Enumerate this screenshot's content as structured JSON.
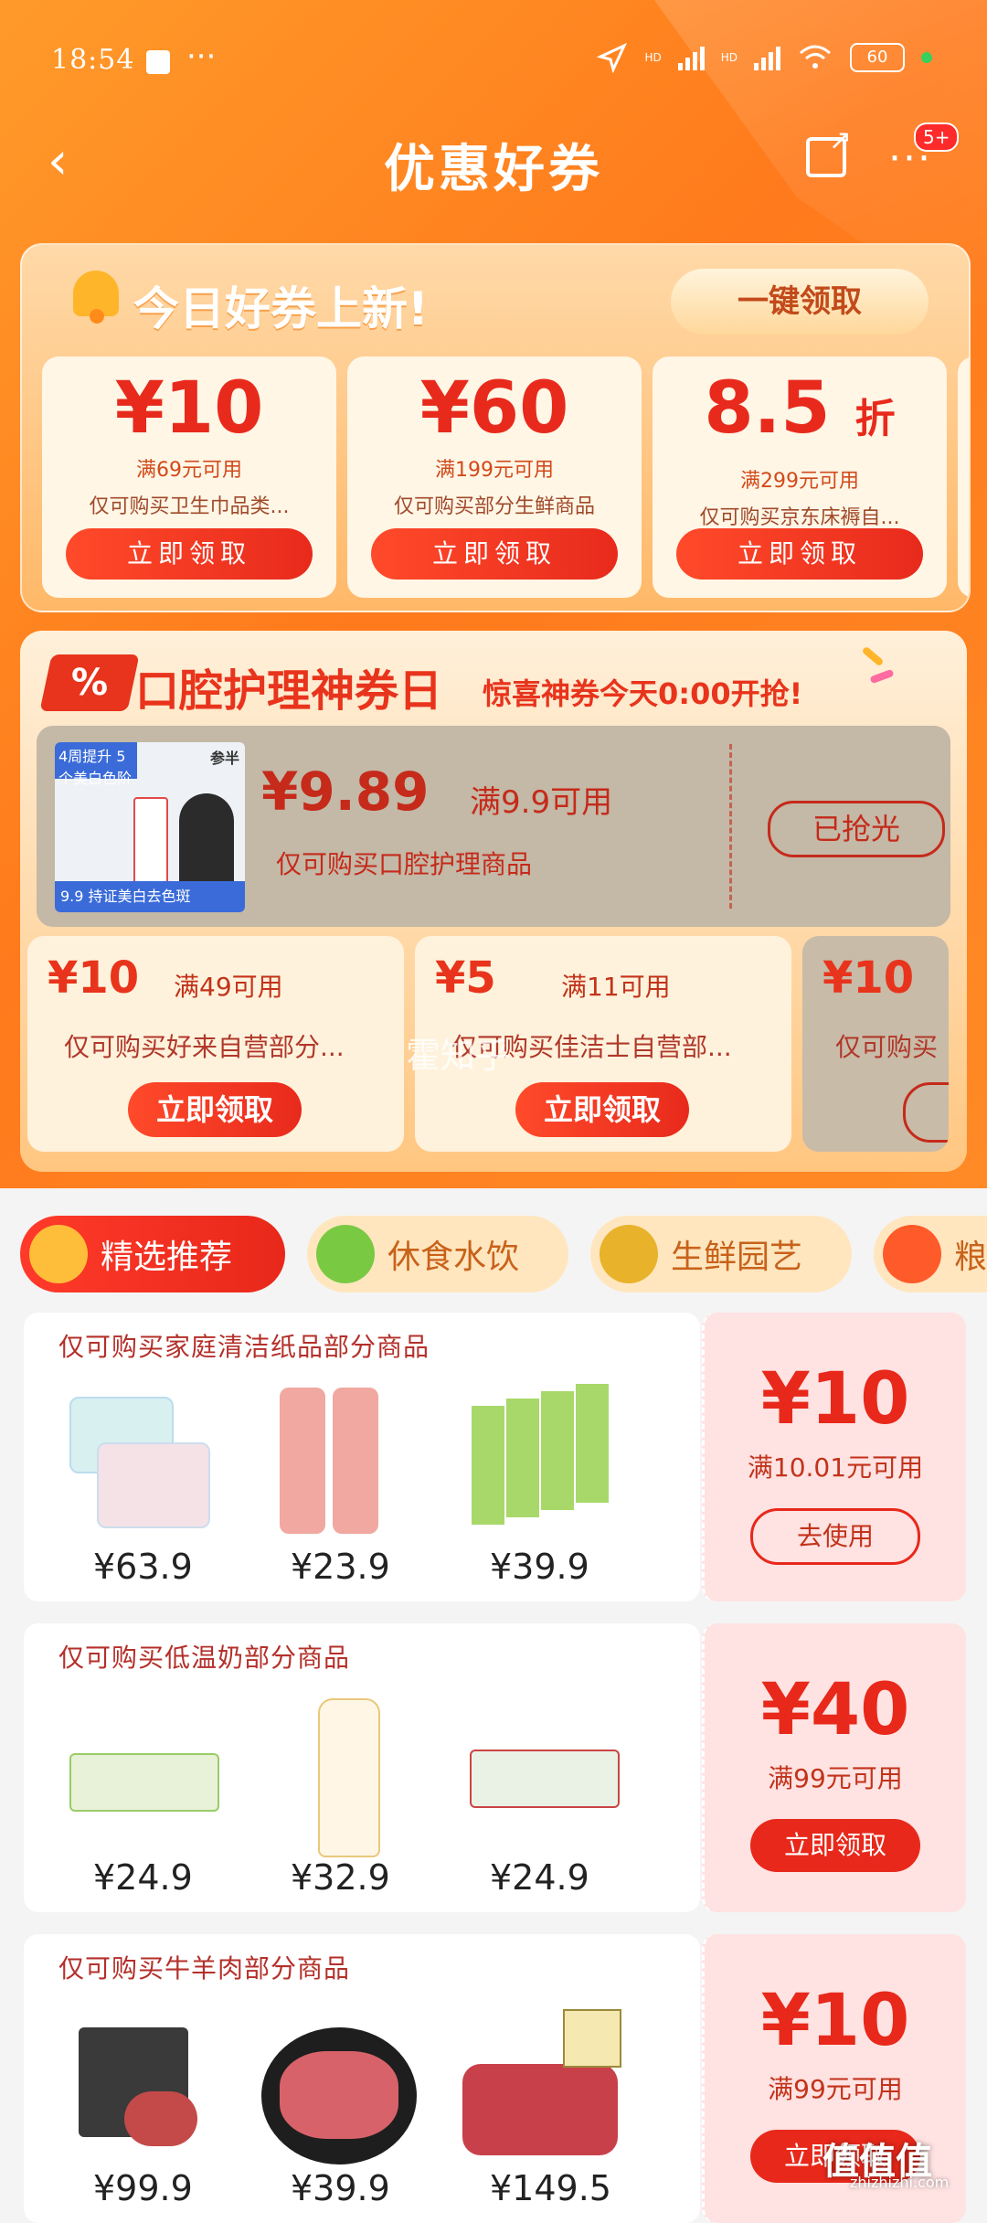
{
  "status": {
    "time": "18:54",
    "more": "···",
    "battery": "60",
    "signal1": "HD",
    "signal2": "HD"
  },
  "nav": {
    "title": "优惠好券",
    "back": "‹",
    "menu": "···",
    "badge": "5+"
  },
  "today": {
    "heading": "今日好券上新!",
    "claim_all": "一键领取",
    "coupons": [
      {
        "amount": "¥10",
        "condition": "满69元可用",
        "scope": "仅可购买卫生巾品类...",
        "button": "立即领取"
      },
      {
        "amount": "¥60",
        "condition": "满199元可用",
        "scope": "仅可购买部分生鲜商品",
        "button": "立即领取"
      },
      {
        "amount": "8.5",
        "unit": "折",
        "condition": "满299元可用",
        "scope": "仅可购买京东床褥自...",
        "button": "立即领取"
      }
    ]
  },
  "oral": {
    "badge": "%",
    "heading": "口腔护理神券日",
    "subheading": "惊喜神券今天0:00开抢!",
    "featured": {
      "image_tag": "4周提升 5个美白色阶",
      "image_brand": "参半",
      "image_strip": "9.9 持证美白去色斑",
      "price": "¥9.89",
      "condition": "满9.9可用",
      "scope": "仅可购买口腔护理商品",
      "state": "已抢光"
    },
    "mini": [
      {
        "amount": "¥10",
        "condition": "满49可用",
        "scope": "仅可购买好来自营部分...",
        "button": "立即领取"
      },
      {
        "amount": "¥5",
        "condition": "满11可用",
        "scope": "仅可购买佳洁士自营部...",
        "button": "立即领取"
      },
      {
        "amount": "¥10",
        "scope": "仅可购买"
      }
    ],
    "watermark": "霍知乎"
  },
  "tabs": [
    {
      "label": "精选推荐",
      "icon": "coupon-icon"
    },
    {
      "label": "休食水饮",
      "icon": "snack-icon"
    },
    {
      "label": "生鲜园艺",
      "icon": "durian-icon"
    },
    {
      "label": "粮",
      "icon": "grain-icon"
    }
  ],
  "rows": [
    {
      "title": "仅可购买家庭清洁纸品部分商品",
      "prices": [
        "¥63.9",
        "¥23.9",
        "¥39.9"
      ],
      "amount": "¥10",
      "condition": "满10.01元可用",
      "action": "去使用"
    },
    {
      "title": "仅可购买低温奶部分商品",
      "prices": [
        "¥24.9",
        "¥32.9",
        "¥24.9"
      ],
      "amount": "¥40",
      "condition": "满99元可用",
      "action": "立即领取"
    },
    {
      "title": "仅可购买牛羊肉部分商品",
      "prices": [
        "¥99.9",
        "¥39.9",
        "¥149.5"
      ],
      "amount": "¥10",
      "condition": "满99元可用",
      "action": "立即领取"
    }
  ],
  "corner": {
    "logo": "值值值",
    "site": "zhizhizhi.com"
  },
  "colors": {
    "accent": "#e8281a",
    "header": "#ff8a26",
    "soft": "#ffe2e2"
  }
}
